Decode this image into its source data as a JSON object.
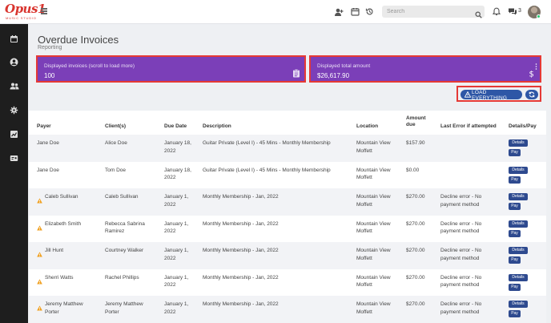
{
  "app": {
    "logo_text": "Opus1",
    "logo_sub": "MUSIC STUDIO"
  },
  "topbar": {
    "search_placeholder": "Search",
    "messages_count": "3",
    "icons": [
      "add-user-icon",
      "calendar-icon",
      "history-icon",
      "bell-icon",
      "chat-icon"
    ]
  },
  "sidebar": {
    "items": [
      "calendar-icon",
      "user-circle-icon",
      "users-icon",
      "gear-icon",
      "chart-icon",
      "id-card-icon"
    ]
  },
  "page": {
    "title": "Overdue Invoices",
    "subtitle": "Reporting"
  },
  "stats": {
    "invoices_label": "Displayed invoices (scroll to load more)",
    "invoices_value": "100",
    "total_label": "Displayed total amount",
    "total_value": "$26,617.90"
  },
  "actions": {
    "load_everything": "LOAD EVERYTHING"
  },
  "table": {
    "headers": {
      "payer": "Payer",
      "clients": "Client(s)",
      "due_date": "Due Date",
      "description": "Description",
      "location": "Location",
      "amount_due_1": "Amount",
      "amount_due_2": "due",
      "last_error": "Last Error if attempted",
      "details_pay": "Details/Pay"
    },
    "details_label": "Details",
    "pay_label": "Pay",
    "rows": [
      {
        "warning": false,
        "payer": [
          "Jane Doe"
        ],
        "client": [
          "Alice Doe"
        ],
        "due": [
          "January 18,",
          "2022"
        ],
        "description": "Guitar Private (Level I) - 45 Mins - Monthly Membership",
        "location": [
          "Mountain View",
          "Moffett"
        ],
        "amount": "$157.90",
        "error": [
          "",
          ""
        ]
      },
      {
        "warning": false,
        "payer": [
          "Jane Doe"
        ],
        "client": [
          "Tom Doe"
        ],
        "due": [
          "January 18,",
          "2022"
        ],
        "description": "Guitar Private (Level I) - 45 Mins - Monthly Membership",
        "location": [
          "Mountain View",
          "Moffett"
        ],
        "amount": "$0.00",
        "error": [
          "",
          ""
        ]
      },
      {
        "warning": true,
        "payer": [
          "Caleb Sullivan"
        ],
        "client": [
          "Caleb Sullivan"
        ],
        "due": [
          "January 1,",
          "2022"
        ],
        "description": "Monthly Membership - Jan, 2022",
        "location": [
          "Mountain View",
          "Moffett"
        ],
        "amount": "$270.00",
        "error": [
          "Decline error - No",
          "payment method"
        ]
      },
      {
        "warning": true,
        "payer": [
          "Elizabeth Smith"
        ],
        "client": [
          "Rebecca Sabrina",
          "Ramirez"
        ],
        "due": [
          "January 1,",
          "2022"
        ],
        "description": "Monthly Membership - Jan, 2022",
        "location": [
          "Mountain View",
          "Moffett"
        ],
        "amount": "$270.00",
        "error": [
          "Decline error - No",
          "payment method"
        ]
      },
      {
        "warning": true,
        "payer": [
          "Jill Hunt"
        ],
        "client": [
          "Courtney Walker"
        ],
        "due": [
          "January 1,",
          "2022"
        ],
        "description": "Monthly Membership - Jan, 2022",
        "location": [
          "Mountain View",
          "Moffett"
        ],
        "amount": "$270.00",
        "error": [
          "Decline error - No",
          "payment method"
        ]
      },
      {
        "warning": true,
        "payer": [
          "Sherri Watts"
        ],
        "client": [
          "Rachel Phillips"
        ],
        "due": [
          "January 1,",
          "2022"
        ],
        "description": "Monthly Membership - Jan, 2022",
        "location": [
          "Mountain View",
          "Moffett"
        ],
        "amount": "$270.00",
        "error": [
          "Decline error - No",
          "payment method"
        ]
      },
      {
        "warning": true,
        "payer": [
          "Jeremy Matthew",
          "Porter"
        ],
        "client": [
          "Jeremy Matthew",
          "Porter"
        ],
        "due": [
          "January 1,",
          "2022"
        ],
        "description": "Monthly Membership - Jan, 2022",
        "location": [
          "Mountain View",
          "Moffett"
        ],
        "amount": "$270.00",
        "error": [
          "Decline error - No",
          "payment method"
        ]
      }
    ]
  },
  "colors": {
    "accent_purple": "#7b3fb8",
    "highlight_red": "#e53935",
    "button_blue": "#2e57a6",
    "warning_orange": "#f0a020",
    "sidebar": "#1e1e1e"
  }
}
